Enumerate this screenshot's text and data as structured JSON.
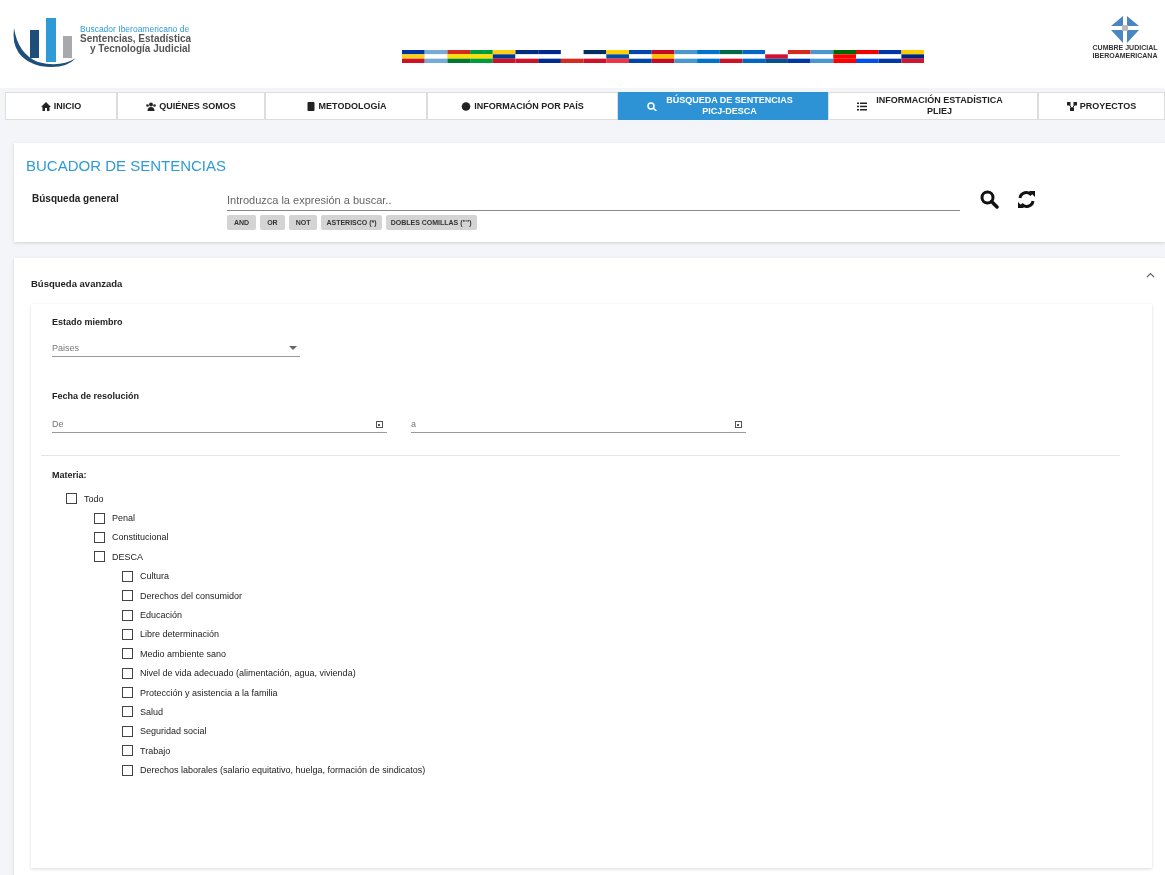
{
  "header": {
    "logo_lines": [
      "Buscador Iberoamericano de",
      "Sentencias, Estadística",
      "y Tecnología Judicial"
    ],
    "partner_logo_lines": [
      "CUMBRE JUDICIAL",
      "IBEROAMERICANA"
    ]
  },
  "nav": [
    {
      "label": "INICIO",
      "selected": false
    },
    {
      "label": "QUIÉNES SOMOS",
      "selected": false
    },
    {
      "label": "METODOLOGÍA",
      "selected": false
    },
    {
      "label": "INFORMACIÓN POR PAÍS",
      "selected": false
    },
    {
      "label": "BÚSQUEDA DE SENTENCIAS PICJ-DESCA",
      "selected": true
    },
    {
      "label": "INFORMACIÓN ESTADÍSTICA PLIEJ",
      "selected": false
    },
    {
      "label": "PROYECTOS",
      "selected": false
    }
  ],
  "search": {
    "title": "BUCADOR DE SENTENCIAS",
    "label": "Búsqueda general",
    "placeholder": "Introduzca la expresión a buscar..",
    "operators": [
      "AND",
      "OR",
      "NOT",
      "ASTERISCO (*)",
      "DOBLES COMILLAS (\"\")"
    ]
  },
  "advanced": {
    "title": "Búsqueda avanzada",
    "expanded": true,
    "member_state": {
      "label": "Estado miembro",
      "placeholder": "Paises"
    },
    "date": {
      "label": "Fecha de resolución",
      "from_placeholder": "De",
      "to_placeholder": "a"
    },
    "subject": {
      "label": "Materia:",
      "tree": [
        {
          "label": "Todo",
          "checked": false,
          "children": [
            {
              "label": "Penal",
              "checked": false
            },
            {
              "label": "Constitucional",
              "checked": false
            },
            {
              "label": "DESCA",
              "checked": false,
              "children": [
                {
                  "label": "Cultura",
                  "checked": false
                },
                {
                  "label": "Derechos del consumidor",
                  "checked": false
                },
                {
                  "label": "Educación",
                  "checked": false
                },
                {
                  "label": "Libre determinación",
                  "checked": false
                },
                {
                  "label": "Medio ambiente sano",
                  "checked": false
                },
                {
                  "label": "Nivel de vida adecuado (alimentación, agua, vivienda)",
                  "checked": false
                },
                {
                  "label": "Protección y asistencia a la familia",
                  "checked": false
                },
                {
                  "label": "Salud",
                  "checked": false
                },
                {
                  "label": "Seguridad social",
                  "checked": false
                },
                {
                  "label": "Trabajo",
                  "checked": false
                },
                {
                  "label": "Derechos laborales (salario equitativo, huelga, formación de sindicatos)",
                  "checked": false
                }
              ]
            }
          ]
        }
      ]
    }
  }
}
